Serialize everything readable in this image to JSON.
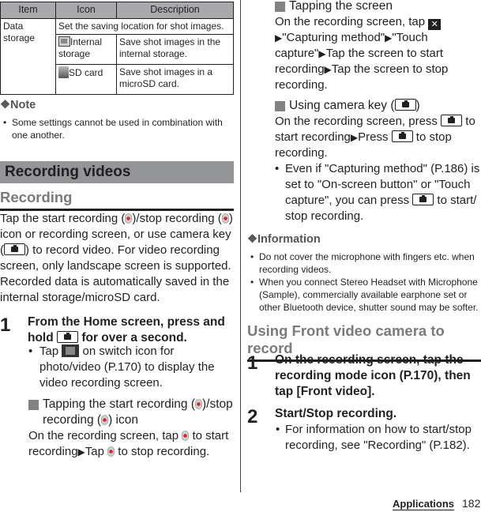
{
  "table": {
    "headers": [
      "Item",
      "Icon",
      "Description"
    ],
    "item": "Data storage",
    "summary": "Set the saving location for shot images.",
    "rows": [
      {
        "icon": "internal-storage-icon",
        "label": "Internal storage",
        "description": "Save shot images in the internal storage."
      },
      {
        "icon": "sd-card-icon",
        "label": "SD card",
        "description": "Save shot images in a microSD card."
      }
    ]
  },
  "note": {
    "heading": "❖Note",
    "items": [
      "Some settings cannot be used in combination with one another."
    ]
  },
  "section_title": "Recording videos",
  "recording": {
    "heading": "Recording",
    "intro_parts": [
      "Tap the start recording (",
      ")/stop recording (",
      ") icon or recording screen, or use camera key (",
      ") to record video. For video recording screen, only landscape screen is supported. Recorded data is automatically saved in the internal storage/microSD card."
    ]
  },
  "step1": {
    "number": "1",
    "title_parts": [
      "From the Home screen, press and hold ",
      " for over a second."
    ],
    "bullet_parts": [
      "Tap ",
      " on switch icon for photo/video (P.170) to display the video recording screen."
    ]
  },
  "tap_icon": {
    "heading_parts": [
      "Tapping the start recording (",
      ")/stop recording (",
      ") icon"
    ],
    "body_parts": [
      "On the recording screen, tap ",
      " to start recording",
      "Tap ",
      " to stop recording."
    ]
  },
  "tap_screen": {
    "heading": "Tapping the screen",
    "body_parts": [
      "On the recording screen, tap ",
      "\"Capturing method\"",
      "\"Touch capture\"",
      "Tap the screen to start recording",
      "Tap the screen to stop recording."
    ]
  },
  "camera_key": {
    "heading_parts": [
      "Using camera key (",
      ")"
    ],
    "body_parts": [
      "On the recording screen, press ",
      " to start recording",
      "Press ",
      " to stop recording."
    ],
    "bullet_parts": [
      "Even if \"Capturing method\" (P.186) is set to \"On-screen button\" or \"Touch capture\", you can press ",
      " to start/ stop recording."
    ]
  },
  "information": {
    "heading": "❖Information",
    "items": [
      "Do not cover the microphone with fingers etc. when recording videos.",
      "When you connect Stereo Headset with Microphone (Sample), commercially available earphone set or other Bluetooth device, shutter sound may be softer."
    ]
  },
  "front_camera": {
    "heading": "Using Front video camera to record",
    "steps": [
      {
        "number": "1",
        "title": "On the recording screen, tap the recording mode icon (P.170), then tap [Front video]."
      },
      {
        "number": "2",
        "title": "Start/Stop recording.",
        "bullet": "For information on how to start/stop recording, see \"Recording\" (P.182)."
      }
    ]
  },
  "footer": {
    "section": "Applications",
    "page": "182"
  },
  "glyphs": {
    "arrow": "▶",
    "tool": "✕"
  }
}
